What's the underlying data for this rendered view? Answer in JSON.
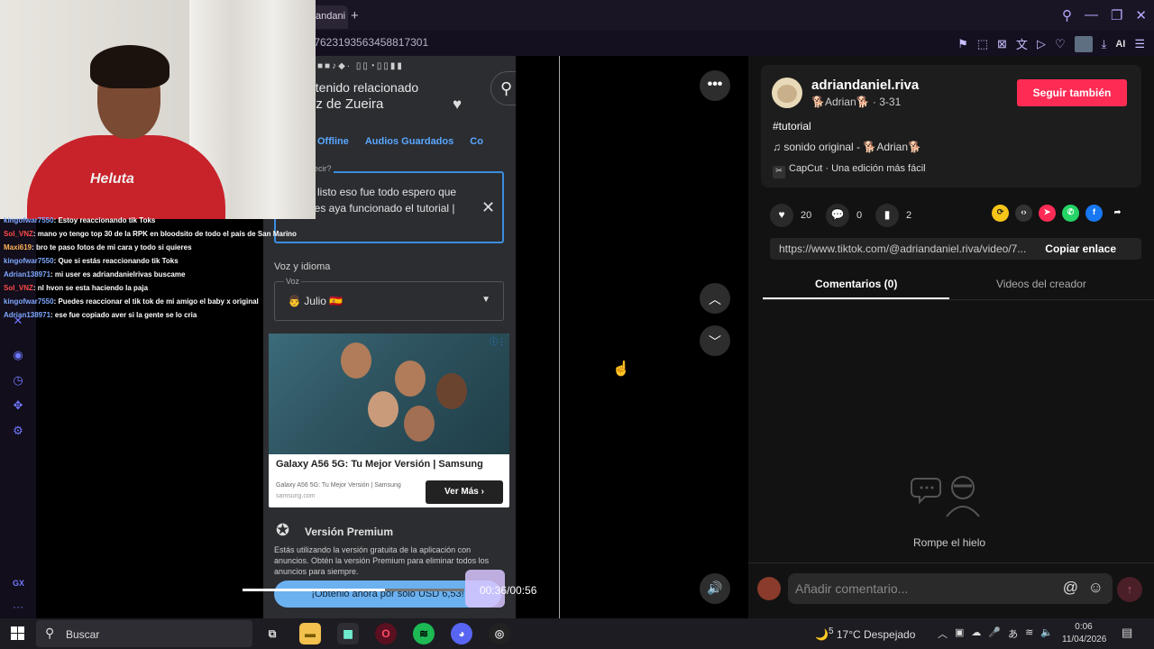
{
  "browser": {
    "tab_label": "andani",
    "url": "/7623193563458817301",
    "ai_label": "AI"
  },
  "sidebar": {
    "gx_label": "GX"
  },
  "phone": {
    "title_line1": "ntenido relacionado",
    "title_line2": "oz de Zueira",
    "tabs": [
      "Offline",
      "Audios Guardados",
      "Co"
    ],
    "textbox_label": "ecir?",
    "textbox_text": "l listo eso fue todo espero que les aya funcionado el tutorial |",
    "voice_section": "Voz y idioma",
    "voice_label": "Voz",
    "voice_value": "👨 Julio 🇪🇸",
    "ad": {
      "title": "Galaxy A56 5G: Tu Mejor Versión | Samsung",
      "subtitle": "Galaxy A56 5G: Tu Mejor Versión | Samsung",
      "domain": "samsung.com",
      "button": "Ver Más"
    },
    "premium_title": "Versión Premium",
    "premium_text": "Estás utilizando la versión gratuita de la aplicación con anuncios. Obtén la versión Premium para eliminar todos los anuncios para siempre.",
    "premium_button": "¡Obtenlo ahora por solo USD 6,53!"
  },
  "player": {
    "time": "00:36/00:56",
    "progress": 0.643
  },
  "chat": [
    {
      "user": "kingofwar7550",
      "text": ": Estoy reaccionando tik Toks",
      "color": "blue"
    },
    {
      "user": "Sol_VNZ",
      "text": ": mano yo tengo top 30 de la RPK en bloodsito de todo el país de San Marino",
      "color": "red"
    },
    {
      "user": "Maxi619",
      "text": ": bro te paso fotos de mi cara y todo si quieres",
      "color": "orange"
    },
    {
      "user": "kingofwar7550",
      "text": ": Que si estás reaccionando tik Toks",
      "color": "blue"
    },
    {
      "user": "Adrian138971",
      "text": ": mi user es adriandanielrivas buscame",
      "color": "blue"
    },
    {
      "user": "Sol_VNZ",
      "text": ": nl hvon se esta haciendo la paja",
      "color": "red"
    },
    {
      "user": "kingofwar7550",
      "text": ": Puedes reaccionar el tik tok de mi amigo el baby x original",
      "color": "blue"
    },
    {
      "user": "Adrian138971",
      "text": ": ese fue copiado aver si la gente se lo cria",
      "color": "blue"
    }
  ],
  "webcam": {
    "shirt_text": "Heluta"
  },
  "author": {
    "name": "adriandaniel.riva",
    "sub": "🐕Adrian🐕 · 3-31",
    "follow": "Seguir también",
    "hashtag": "#tutorial",
    "sound": "♫  sonido original - 🐕Adrian🐕",
    "capcut": "CapCut · Una edición más fácil"
  },
  "stats": {
    "likes": "20",
    "comments": "0",
    "saves": "2"
  },
  "link": {
    "url": "https://www.tiktok.com/@adriandaniel.riva/video/7...",
    "copy": "Copiar enlace"
  },
  "tabs": {
    "comments": "Comentarios (0)",
    "videos": "Videos del creador"
  },
  "empty": {
    "text": "Rompe el hielo"
  },
  "comment_box": {
    "placeholder": "Añadir comentario...",
    "at": "@"
  },
  "taskbar": {
    "search": "Buscar",
    "weather": "17°C  Despejado",
    "time": "0:06",
    "date": "11/04/2026",
    "weather_badge": "5"
  },
  "colors": {
    "accent": "#fe2c55",
    "opera": "#6f78ff"
  }
}
